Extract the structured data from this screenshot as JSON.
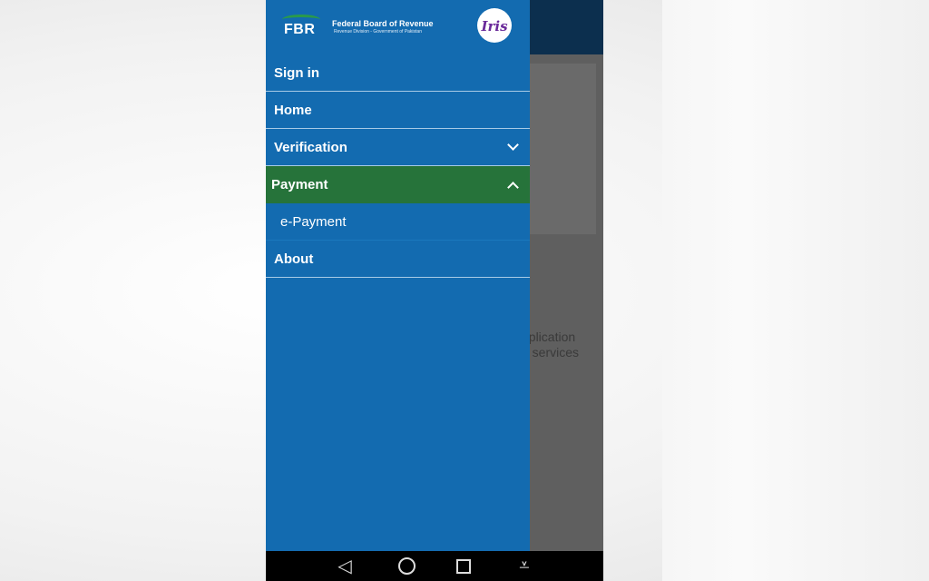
{
  "header": {
    "logo_text": "FBR",
    "org_name": "Federal Board of Revenue",
    "org_sub": "Revenue Division - Government of Pakistan",
    "app_logo": "Iris"
  },
  "menu": [
    {
      "label": "Sign in"
    },
    {
      "label": "Home"
    },
    {
      "label": "Verification",
      "chevron": "chevron-down"
    },
    {
      "label": "Payment",
      "chevron": "chevron-up",
      "expanded": true,
      "color": "#26733a"
    },
    {
      "label": "e-Payment",
      "submenu": true
    },
    {
      "label": "About"
    }
  ],
  "background": {
    "text_line1": "pplication",
    "text_line2": "d services"
  },
  "colors": {
    "drawer": "#136bb0",
    "active": "#26733a",
    "appbar": "#0c2f4e"
  }
}
